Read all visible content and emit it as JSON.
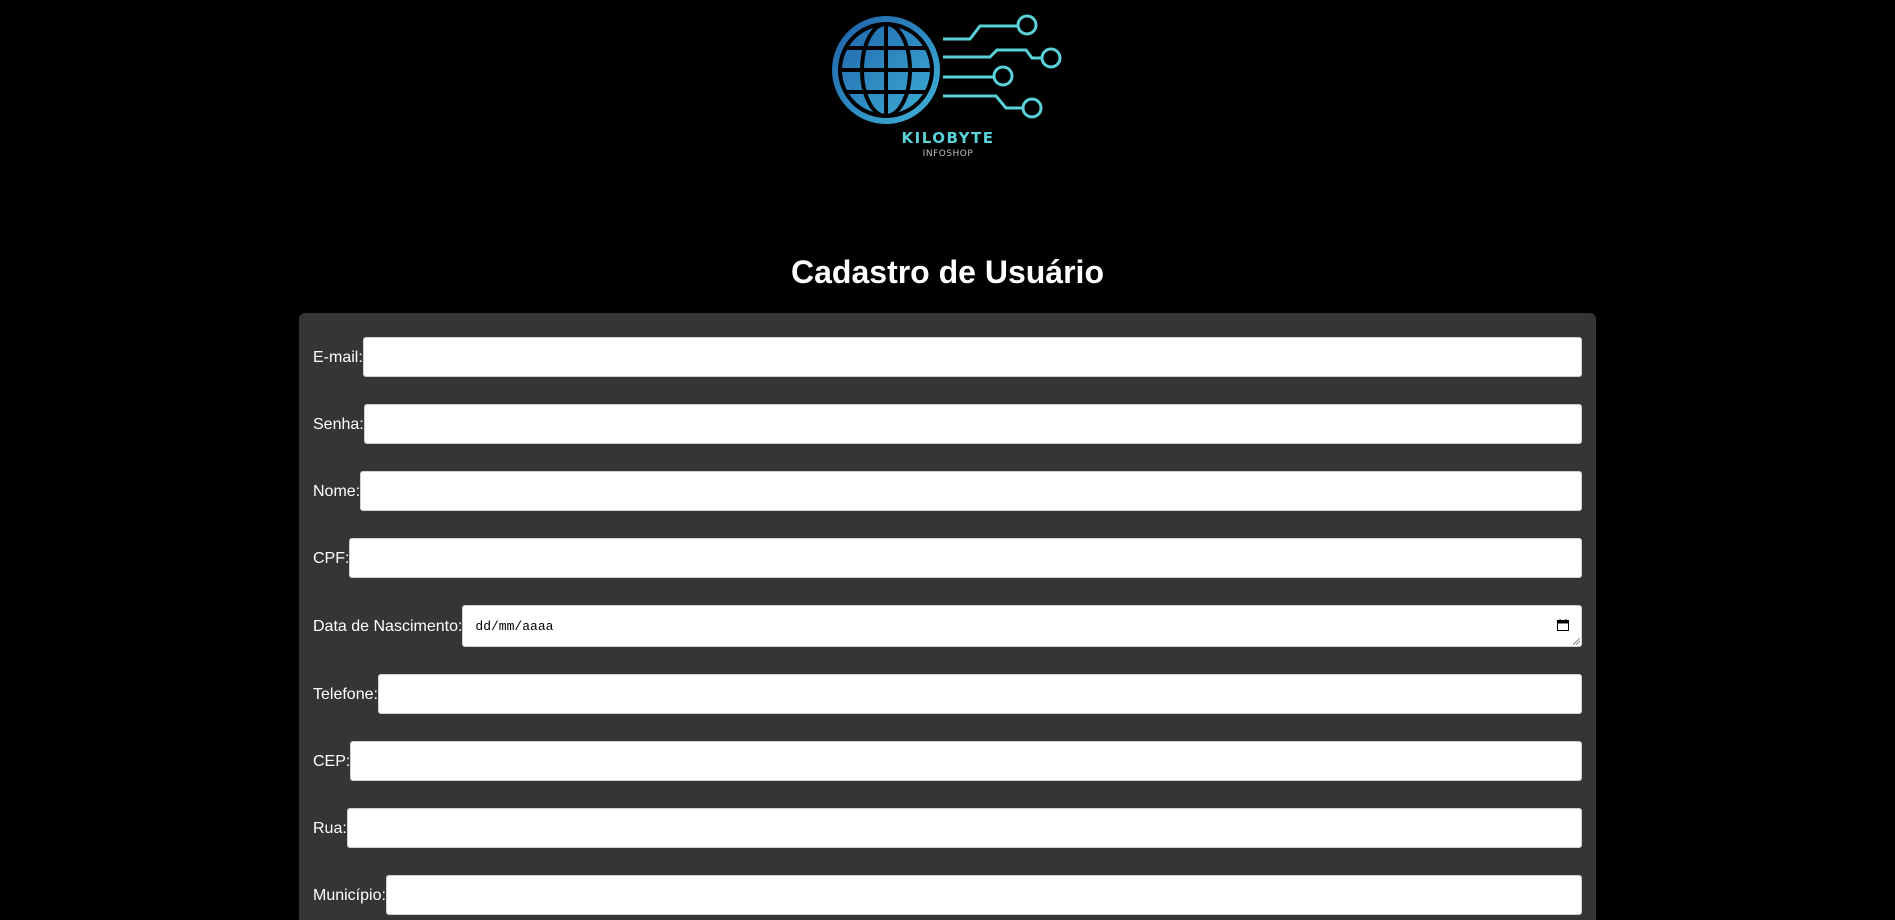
{
  "brand": {
    "name": "KILOBYTE",
    "subtitle": "INFOSHOP",
    "colors": {
      "globe_dark": "#1d5fa8",
      "globe_light": "#3fb4d8",
      "circuit": "#5ad0d8"
    }
  },
  "page": {
    "title": "Cadastro de Usuário"
  },
  "form": {
    "fields": [
      {
        "label": "E-mail:",
        "value": "",
        "type": "email"
      },
      {
        "label": "Senha:",
        "value": "",
        "type": "password"
      },
      {
        "label": "Nome:",
        "value": "",
        "type": "text"
      },
      {
        "label": "CPF:",
        "value": "",
        "type": "text"
      },
      {
        "label": "Data de Nascimento:",
        "value": "",
        "type": "date",
        "placeholder": "dd/mm/aaaa"
      },
      {
        "label": "Telefone:",
        "value": "",
        "type": "text"
      },
      {
        "label": "CEP:",
        "value": "",
        "type": "text"
      },
      {
        "label": "Rua:",
        "value": "",
        "type": "text"
      },
      {
        "label": "Município:",
        "value": "",
        "type": "text"
      }
    ]
  },
  "colors": {
    "background": "#000000",
    "panel": "#353535",
    "input": "#ffffff",
    "text": "#ffffff"
  },
  "icons": {
    "logo": "globe-circuit-logo",
    "date": "calendar-icon"
  }
}
